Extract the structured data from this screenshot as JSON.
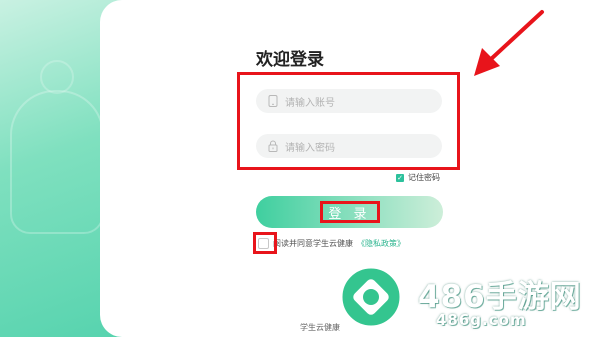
{
  "login": {
    "title": "欢迎登录",
    "account_placeholder": "请输入账号",
    "password_placeholder": "请输入密码",
    "remember_label": "记住密码",
    "remember_checked": true,
    "button_label": "登 录",
    "agree_text": "阅读并同意学生云健康",
    "policy_link": "《隐私政策》"
  },
  "footer": {
    "app_name": "学生云健康"
  },
  "watermark": {
    "brand": "486手游网",
    "url": "486g.com"
  },
  "colors": {
    "accent": "#2cc19c",
    "annotation": "#e8141b"
  },
  "icons": {
    "account": "phone-icon",
    "password": "lock-icon",
    "check": "check-icon"
  }
}
